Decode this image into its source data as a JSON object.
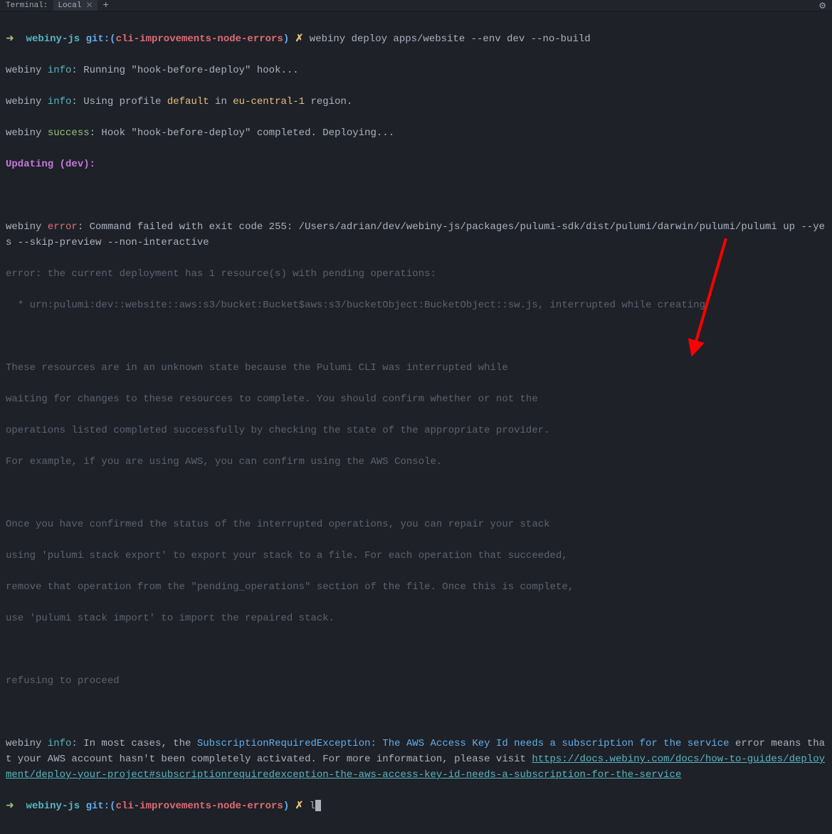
{
  "tabbar": {
    "label": "Terminal:",
    "tab_name": "Local",
    "plus": "+",
    "gear": "⚙"
  },
  "prompt": {
    "arrow": "➜",
    "dir": "webiny-js",
    "git_prefix": "git:(",
    "branch": "cli-improvements-node-errors",
    "git_suffix": ")",
    "x": "✗"
  },
  "lines": {
    "cmd1": "webiny deploy apps/website --env dev --no-build",
    "l1_a": "webiny ",
    "l1_b": "info",
    "l1_c": ": Running \"hook-before-deploy\" hook...",
    "l2_a": "webiny ",
    "l2_b": "info",
    "l2_c": ": Using profile ",
    "l2_d": "default",
    "l2_e": " in ",
    "l2_f": "eu-central-1",
    "l2_g": " region.",
    "l3_a": "webiny ",
    "l3_b": "success",
    "l3_c": ": Hook \"hook-before-deploy\" completed. Deploying...",
    "l4": "Updating (dev):",
    "l5_a": "webiny ",
    "l5_b": "error",
    "l5_c": ": Command failed with exit code 255: /Users/adrian/dev/webiny-js/packages/pulumi-sdk/dist/pulumi/darwin/pulumi/pulumi up --yes --skip-preview --non-interactive",
    "d1": "error: the current deployment has 1 resource(s) with pending operations:",
    "d2": "  * urn:pulumi:dev::website::aws:s3/bucket:Bucket$aws:s3/bucketObject:BucketObject::sw.js, interrupted while creating",
    "d3": "These resources are in an unknown state because the Pulumi CLI was interrupted while",
    "d4": "waiting for changes to these resources to complete. You should confirm whether or not the",
    "d5": "operations listed completed successfully by checking the state of the appropriate provider.",
    "d6": "For example, if you are using AWS, you can confirm using the AWS Console.",
    "d7": "Once you have confirmed the status of the interrupted operations, you can repair your stack",
    "d8": "using 'pulumi stack export' to export your stack to a file. For each operation that succeeded,",
    "d9": "remove that operation from the \"pending_operations\" section of the file. Once this is complete,",
    "d10": "use 'pulumi stack import' to import the repaired stack.",
    "d11": "refusing to proceed",
    "l6_a": "webiny ",
    "l6_b": "info",
    "l6_c": ": In most cases, the ",
    "l6_d": "SubscriptionRequiredException: The AWS Access Key Id needs a subscription for the service",
    "l6_e": " error means that your AWS account hasn't been completely activated. For more information, please visit ",
    "l6_f": "https://docs.webiny.com/docs/how-to-guides/deployment/deploy-your-project#subscriptionrequiredexception-the-aws-access-key-id-needs-a-subscription-for-the-service",
    "cmd2": "l"
  }
}
